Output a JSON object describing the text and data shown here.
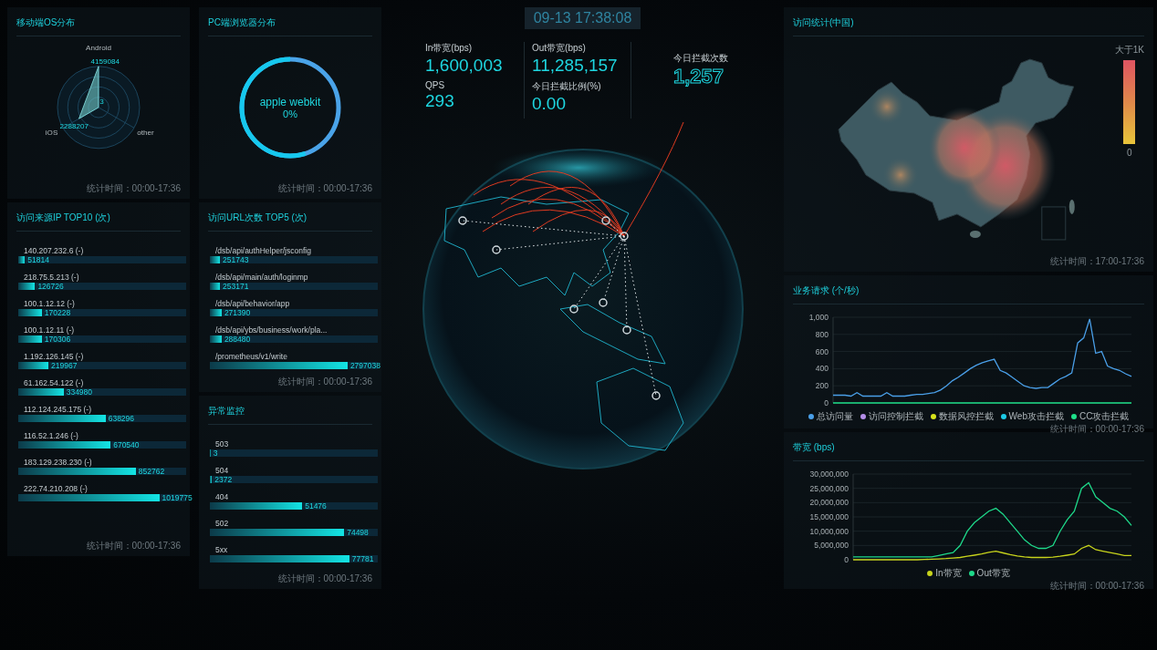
{
  "mobile_os": {
    "title": "移动端OS分布",
    "items": [
      {
        "label": "Android",
        "value": "4159084"
      },
      {
        "label": "iOS",
        "value": "2288207"
      },
      {
        "label": "other",
        "value": "3"
      }
    ],
    "footer": "统计时间：00:00-17:36"
  },
  "pc_browser": {
    "title": "PC端浏览器分布",
    "center_label": "apple webkit",
    "center_value": "0%",
    "footer": "统计时间：00:00-17:36"
  },
  "ip_top10": {
    "title": "访问来源IP TOP10 (次)",
    "rows": [
      {
        "label": "140.207.232.6 (-)",
        "value": "51814",
        "level": 0.04
      },
      {
        "label": "218.75.5.213 (-)",
        "value": "126726",
        "level": 0.1
      },
      {
        "label": "100.1.12.12 (-)",
        "value": "170228",
        "level": 0.14
      },
      {
        "label": "100.1.12.11 (-)",
        "value": "170306",
        "level": 0.14
      },
      {
        "label": "1.192.126.145 (-)",
        "value": "219967",
        "level": 0.18
      },
      {
        "label": "61.162.54.122 (-)",
        "value": "334980",
        "level": 0.27
      },
      {
        "label": "112.124.245.175 (-)",
        "value": "638296",
        "level": 0.52
      },
      {
        "label": "116.52.1.246 (-)",
        "value": "670540",
        "level": 0.55
      },
      {
        "label": "183.129.238.230 (-)",
        "value": "852762",
        "level": 0.7
      },
      {
        "label": "222.74.210.208 (-)",
        "value": "1019775",
        "level": 0.84
      }
    ],
    "footer": "统计时间：00:00-17:36"
  },
  "url_top5": {
    "title": "访问URL次数 TOP5 (次)",
    "rows": [
      {
        "label": "/dsb/api/authHelper/jsconfig",
        "value": "251743",
        "level": 0.06
      },
      {
        "label": "/dsb/api/main/auth/loginmp",
        "value": "253171",
        "level": 0.06
      },
      {
        "label": "/dsb/api/behavior/app",
        "value": "271390",
        "level": 0.07
      },
      {
        "label": "/dsb/api/ybs/business/work/pla...",
        "value": "288480",
        "level": 0.07
      },
      {
        "label": "/prometheus/v1/write",
        "value": "2797038",
        "level": 0.82
      }
    ],
    "footer": "统计时间：00:00-17:36"
  },
  "anomaly": {
    "title": "异常监控",
    "rows": [
      {
        "label": "503",
        "value": "3",
        "level": 0.004
      },
      {
        "label": "504",
        "value": "2372",
        "level": 0.012
      },
      {
        "label": "404",
        "value": "51476",
        "level": 0.55
      },
      {
        "label": "502",
        "value": "74498",
        "level": 0.8
      },
      {
        "label": "5xx",
        "value": "77781",
        "level": 0.83
      }
    ],
    "footer": "统计时间：00:00-17:36"
  },
  "clock": "09-13 17:38:08",
  "stats": [
    {
      "label": "In带宽(bps)",
      "value": "1,600,003"
    },
    {
      "label": "Out带宽(bps)",
      "value": "11,285,157"
    },
    {
      "label": "QPS",
      "value": "293"
    },
    {
      "label": "今日拦截比例(%)",
      "value": "0.00"
    }
  ],
  "blocked_today": {
    "label": "今日拦截次数",
    "value": "1,257"
  },
  "china_map": {
    "title": "访问统计(中国)",
    "legend_max": "大于1K",
    "legend_min": "0",
    "footer": "统计时间：17:00-17:36"
  },
  "requests": {
    "title": "业务请求 (个/秒)",
    "footer": "统计时间：00:00-17:36",
    "chart_data": {
      "type": "line",
      "grid": true,
      "legend": true,
      "ylim": [
        0,
        1000
      ],
      "yticks": [
        0,
        200,
        400,
        600,
        800,
        {
          "value": 1000,
          "label": "1,000"
        }
      ],
      "series": [
        {
          "name": "总访问量",
          "color": "#4a9fe8",
          "values": [
            90,
            90,
            90,
            80,
            120,
            80,
            80,
            80,
            80,
            120,
            80,
            80,
            80,
            90,
            100,
            100,
            110,
            120,
            150,
            200,
            260,
            300,
            350,
            400,
            440,
            470,
            490,
            510,
            380,
            350,
            300,
            250,
            200,
            180,
            170,
            180,
            180,
            230,
            280,
            310,
            350,
            700,
            760,
            980,
            580,
            600,
            430,
            400,
            380,
            340,
            310
          ]
        },
        {
          "name": "访问控制拦截",
          "color": "#b48ee8",
          "values": [
            null
          ]
        },
        {
          "name": "数据风控拦截",
          "color": "#d8e41c",
          "values": [
            null
          ]
        },
        {
          "name": "Web攻击拦截",
          "color": "#1ccbe6",
          "values": [
            null
          ]
        },
        {
          "name": "CC攻击拦截",
          "color": "#1ee08a",
          "values": [
            0,
            0,
            0,
            0,
            0,
            0,
            0,
            0,
            0,
            0,
            0,
            0,
            0,
            0,
            0,
            0,
            0,
            0,
            0,
            0,
            0,
            0,
            0,
            0,
            0,
            0,
            0,
            0,
            0,
            0,
            0,
            0,
            0,
            0,
            0,
            0,
            0,
            0,
            0,
            0,
            0,
            0,
            0,
            0,
            0,
            0,
            0,
            0,
            0,
            0,
            0
          ]
        }
      ]
    }
  },
  "bandwidth": {
    "title": "带宽 (bps)",
    "footer": "统计时间：00:00-17:36",
    "chart_data": {
      "type": "line",
      "grid": true,
      "legend": true,
      "ylim": [
        0,
        30000000
      ],
      "yticks": [
        0,
        {
          "value": 5000000,
          "label": "5,000,000"
        },
        {
          "value": 10000000,
          "label": "10,000,000"
        },
        {
          "value": 15000000,
          "label": "15,000,000"
        },
        {
          "value": 20000000,
          "label": "20,000,000"
        },
        {
          "value": 25000000,
          "label": "25,000,000"
        },
        {
          "value": 30000000,
          "label": "30,000,000"
        }
      ],
      "series": [
        {
          "name": "In带宽",
          "color": "#c8d41c",
          "values": [
            0,
            0,
            0,
            0,
            0,
            0,
            0,
            0,
            0,
            0,
            100000,
            200000,
            300000,
            400000,
            600000,
            800000,
            1200000,
            1600000,
            2000000,
            2600000,
            3000000,
            2400000,
            1800000,
            1300000,
            1000000,
            800000,
            800000,
            800000,
            900000,
            1200000,
            1600000,
            2000000,
            4000000,
            5000000,
            3500000,
            3000000,
            2500000,
            2000000,
            1500000,
            1500000
          ]
        },
        {
          "name": "Out带宽",
          "color": "#1ed98a",
          "values": [
            1000000,
            1000000,
            1000000,
            1000000,
            1000000,
            1000000,
            1000000,
            1000000,
            1000000,
            1000000,
            1000000,
            1000000,
            1500000,
            2000000,
            2500000,
            5000000,
            10000000,
            13000000,
            15000000,
            17000000,
            18000000,
            16000000,
            13000000,
            10000000,
            7000000,
            5000000,
            4000000,
            4000000,
            5000000,
            10000000,
            14000000,
            17000000,
            25000000,
            27000000,
            22000000,
            20000000,
            18000000,
            17000000,
            15000000,
            12000000
          ]
        }
      ]
    }
  }
}
